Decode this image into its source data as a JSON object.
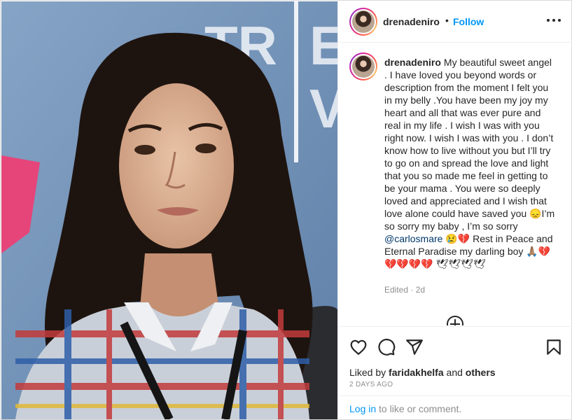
{
  "post": {
    "photo_alt": "",
    "accent_color": "#0095f6"
  },
  "header": {
    "username": "drenadeniro",
    "separator": "•",
    "follow_label": "Follow",
    "more_icon": "more-horizontal-icon"
  },
  "caption": {
    "username": "drenadeniro",
    "part1": "My beautiful sweet angel . I have loved you beyond words or description from the moment I felt you in my belly .You have been my joy my heart and all that was ever pure and real in my life . I wish I was with you right now. I wish I was with you . I don’t know how to live without you but I’ll try to go on and spread the love and light that you so made me feel in getting to be your mama . You were so deeply loved and appreciated and I wish that love alone could have saved you 😞I’m so sorry my baby , I’m so sorry ",
    "mention": "@carlosmare",
    "part2": " 😢💔 Rest in Peace and Eternal Paradise my darling boy 🙏🏽💔💔💔💔💔 🕊🕊🕊🕊",
    "edited": "Edited",
    "age": "2d"
  },
  "actions": {
    "like_icon": "heart-icon",
    "comment_icon": "comment-icon",
    "share_icon": "send-icon",
    "save_icon": "bookmark-icon",
    "add_comment_icon": "add-circle-icon"
  },
  "likes": {
    "prefix": "Liked by",
    "user": "faridakhelfa",
    "joiner": "and",
    "others": "others"
  },
  "timestamp": "2 DAYS AGO",
  "login": {
    "link": "Log in",
    "rest": "to like or comment."
  }
}
